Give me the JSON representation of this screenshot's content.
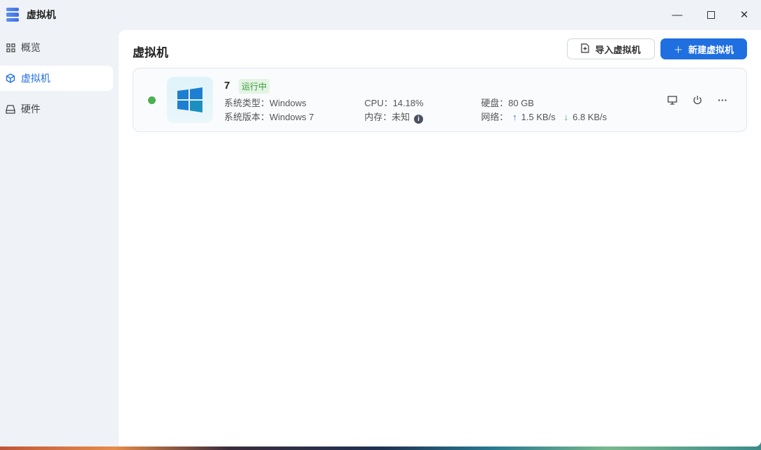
{
  "window": {
    "title": "虚拟机"
  },
  "sidebar": {
    "items": [
      {
        "label": "概览",
        "icon": "grid-icon"
      },
      {
        "label": "虚拟机",
        "icon": "cube-icon",
        "active": true
      },
      {
        "label": "硬件",
        "icon": "drive-icon"
      }
    ]
  },
  "main": {
    "title": "虚拟机",
    "import_label": "导入虚拟机",
    "new_label": "新建虚拟机"
  },
  "vm": {
    "name": "7",
    "status": "运行中",
    "os_type": "系统类型：Windows",
    "os_version": "系统版本：Windows 7",
    "cpu": "CPU：14.18%",
    "memory": "内存：未知",
    "disk": "硬盘：80 GB",
    "net_label": "网络：",
    "net_up": "1.5 KB/s",
    "net_down": "6.8 KB/s"
  },
  "colors": {
    "accent": "#1f6fe0",
    "running": "#4caf50"
  }
}
